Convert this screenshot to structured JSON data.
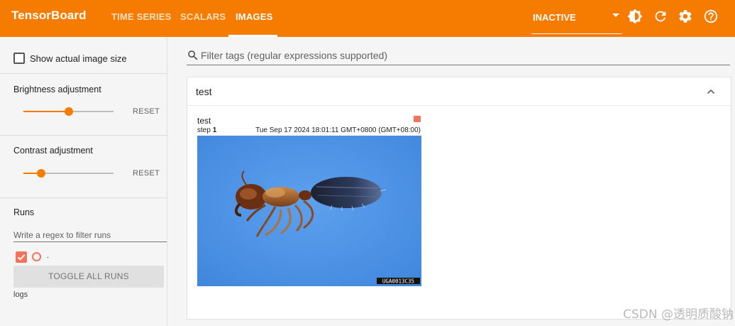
{
  "app": {
    "title": "TensorBoard"
  },
  "nav": {
    "tabs": [
      {
        "label": "TIME SERIES"
      },
      {
        "label": "SCALARS"
      },
      {
        "label": "IMAGES"
      }
    ],
    "active_tab": "IMAGES"
  },
  "top_controls": {
    "run_select": "INACTIVE",
    "icons": [
      "theme-brightness-icon",
      "refresh-icon",
      "settings-gear-icon",
      "help-icon"
    ]
  },
  "sidebar": {
    "show_actual_size_label": "Show actual image size",
    "show_actual_size_checked": false,
    "brightness": {
      "label": "Brightness adjustment",
      "reset_label": "RESET",
      "level": 0.5
    },
    "contrast": {
      "label": "Contrast adjustment",
      "reset_label": "RESET",
      "level": 0.2
    },
    "runs": {
      "title": "Runs",
      "filter_placeholder": "Write a regex to filter runs",
      "run_name": ".",
      "run_checked": true,
      "run_color": "#f4735a",
      "toggle_all_label": "TOGGLE ALL RUNS",
      "group_label": "logs"
    }
  },
  "main": {
    "tag_filter_placeholder": "Filter tags (regular expressions supported)",
    "card": {
      "title": "test",
      "collapsed": false,
      "image": {
        "tag": "test",
        "step_label": "step",
        "step_value": "1",
        "timestamp": "Tue Sep 17 2024 18:01:11 GMT+0800 (GMT+08:00)",
        "specimen_code": "UGA0013C35"
      }
    }
  },
  "watermark": "CSDN @透明质酸钠",
  "colors": {
    "accent": "#f57c00",
    "run": "#f4735a",
    "image_bg": "#4a8fe0"
  }
}
